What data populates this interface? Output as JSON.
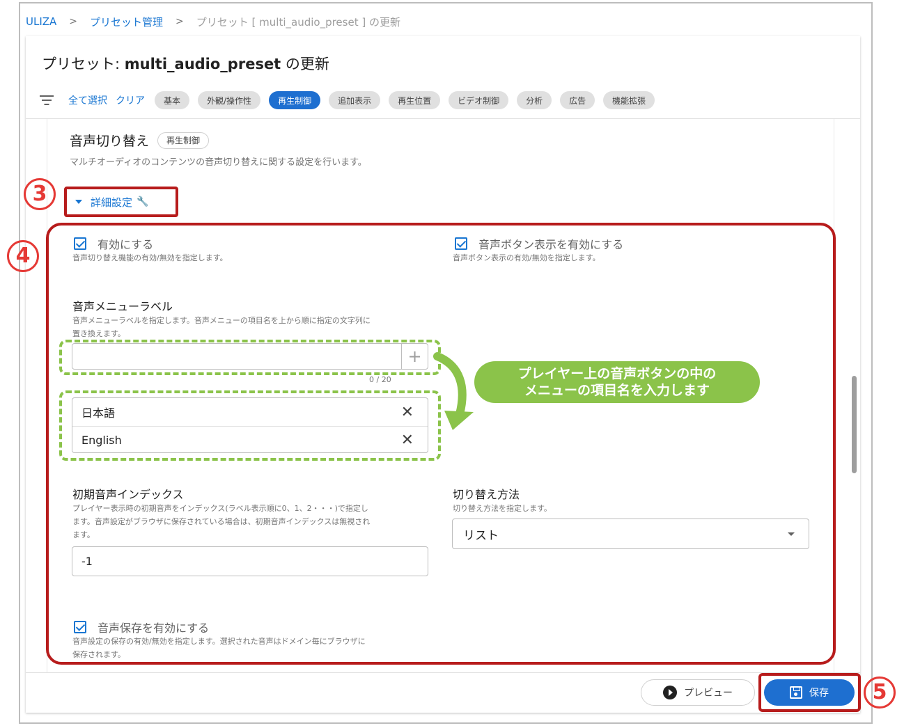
{
  "breadcrumb": {
    "root": "ULIZA",
    "section": "プリセット管理",
    "current": "プリセット [ multi_audio_preset ] の更新"
  },
  "page": {
    "title_prefix": "プリセット: ",
    "preset_name": "multi_audio_preset",
    "title_suffix": " の更新"
  },
  "filter": {
    "select_all": "全て選択",
    "clear": "クリア",
    "chips": [
      "基本",
      "外観/操作性",
      "再生制御",
      "追加表示",
      "再生位置",
      "ビデオ制御",
      "分析",
      "広告",
      "機能拡張"
    ],
    "active_chip": "再生制御"
  },
  "section": {
    "title": "音声切り替え",
    "tag": "再生制御",
    "description": "マルチオーディオのコンテンツの音声切り替えに関する設定を行います。"
  },
  "advanced": {
    "label": "詳細設定",
    "icon": "wrench-icon"
  },
  "markers": {
    "m3": "3",
    "m4": "4",
    "m5": "5"
  },
  "settings": {
    "enable": {
      "label": "有効にする",
      "help": "音声切り替え機能の有効/無効を指定します。",
      "checked": true
    },
    "button_display": {
      "label": "音声ボタン表示を有効にする",
      "help": "音声ボタン表示の有効/無効を指定します。",
      "checked": true
    },
    "menu_label": {
      "label": "音声メニューラベル",
      "help1": "音声メニューラベルを指定します。音声メニューの項目名を上から順に指定の文字列に",
      "help2": "置き換えます。",
      "input_value": "",
      "counter": "0 / 20",
      "items": [
        "日本語",
        "English"
      ]
    },
    "initial_index": {
      "label": "初期音声インデックス",
      "help1": "プレイヤー表示時の初期音声をインデックス(ラベル表示順に0、1、2・・・)で指定し",
      "help2": "ます。音声設定がブラウザに保存されている場合は、初期音声インデックスは無視され",
      "help3": "ます。",
      "value": "-1"
    },
    "switch_method": {
      "label": "切り替え方法",
      "help": "切り替え方法を指定します。",
      "value": "リスト"
    },
    "save_audio": {
      "label": "音声保存を有効にする",
      "help1": "音声設定の保存の有効/無効を指定します。選択された音声はドメイン毎にブラウザに",
      "help2": "保存されます。",
      "checked": true
    }
  },
  "callout": {
    "line1": "プレイヤー上の音声ボタンの中の",
    "line2": "メニューの項目名を入力します"
  },
  "footer": {
    "preview": "プレビュー",
    "save": "保存"
  },
  "colors": {
    "primary": "#1e6fd0",
    "annotation_red": "#b71c1c",
    "annotation_green": "#8bc34a"
  }
}
